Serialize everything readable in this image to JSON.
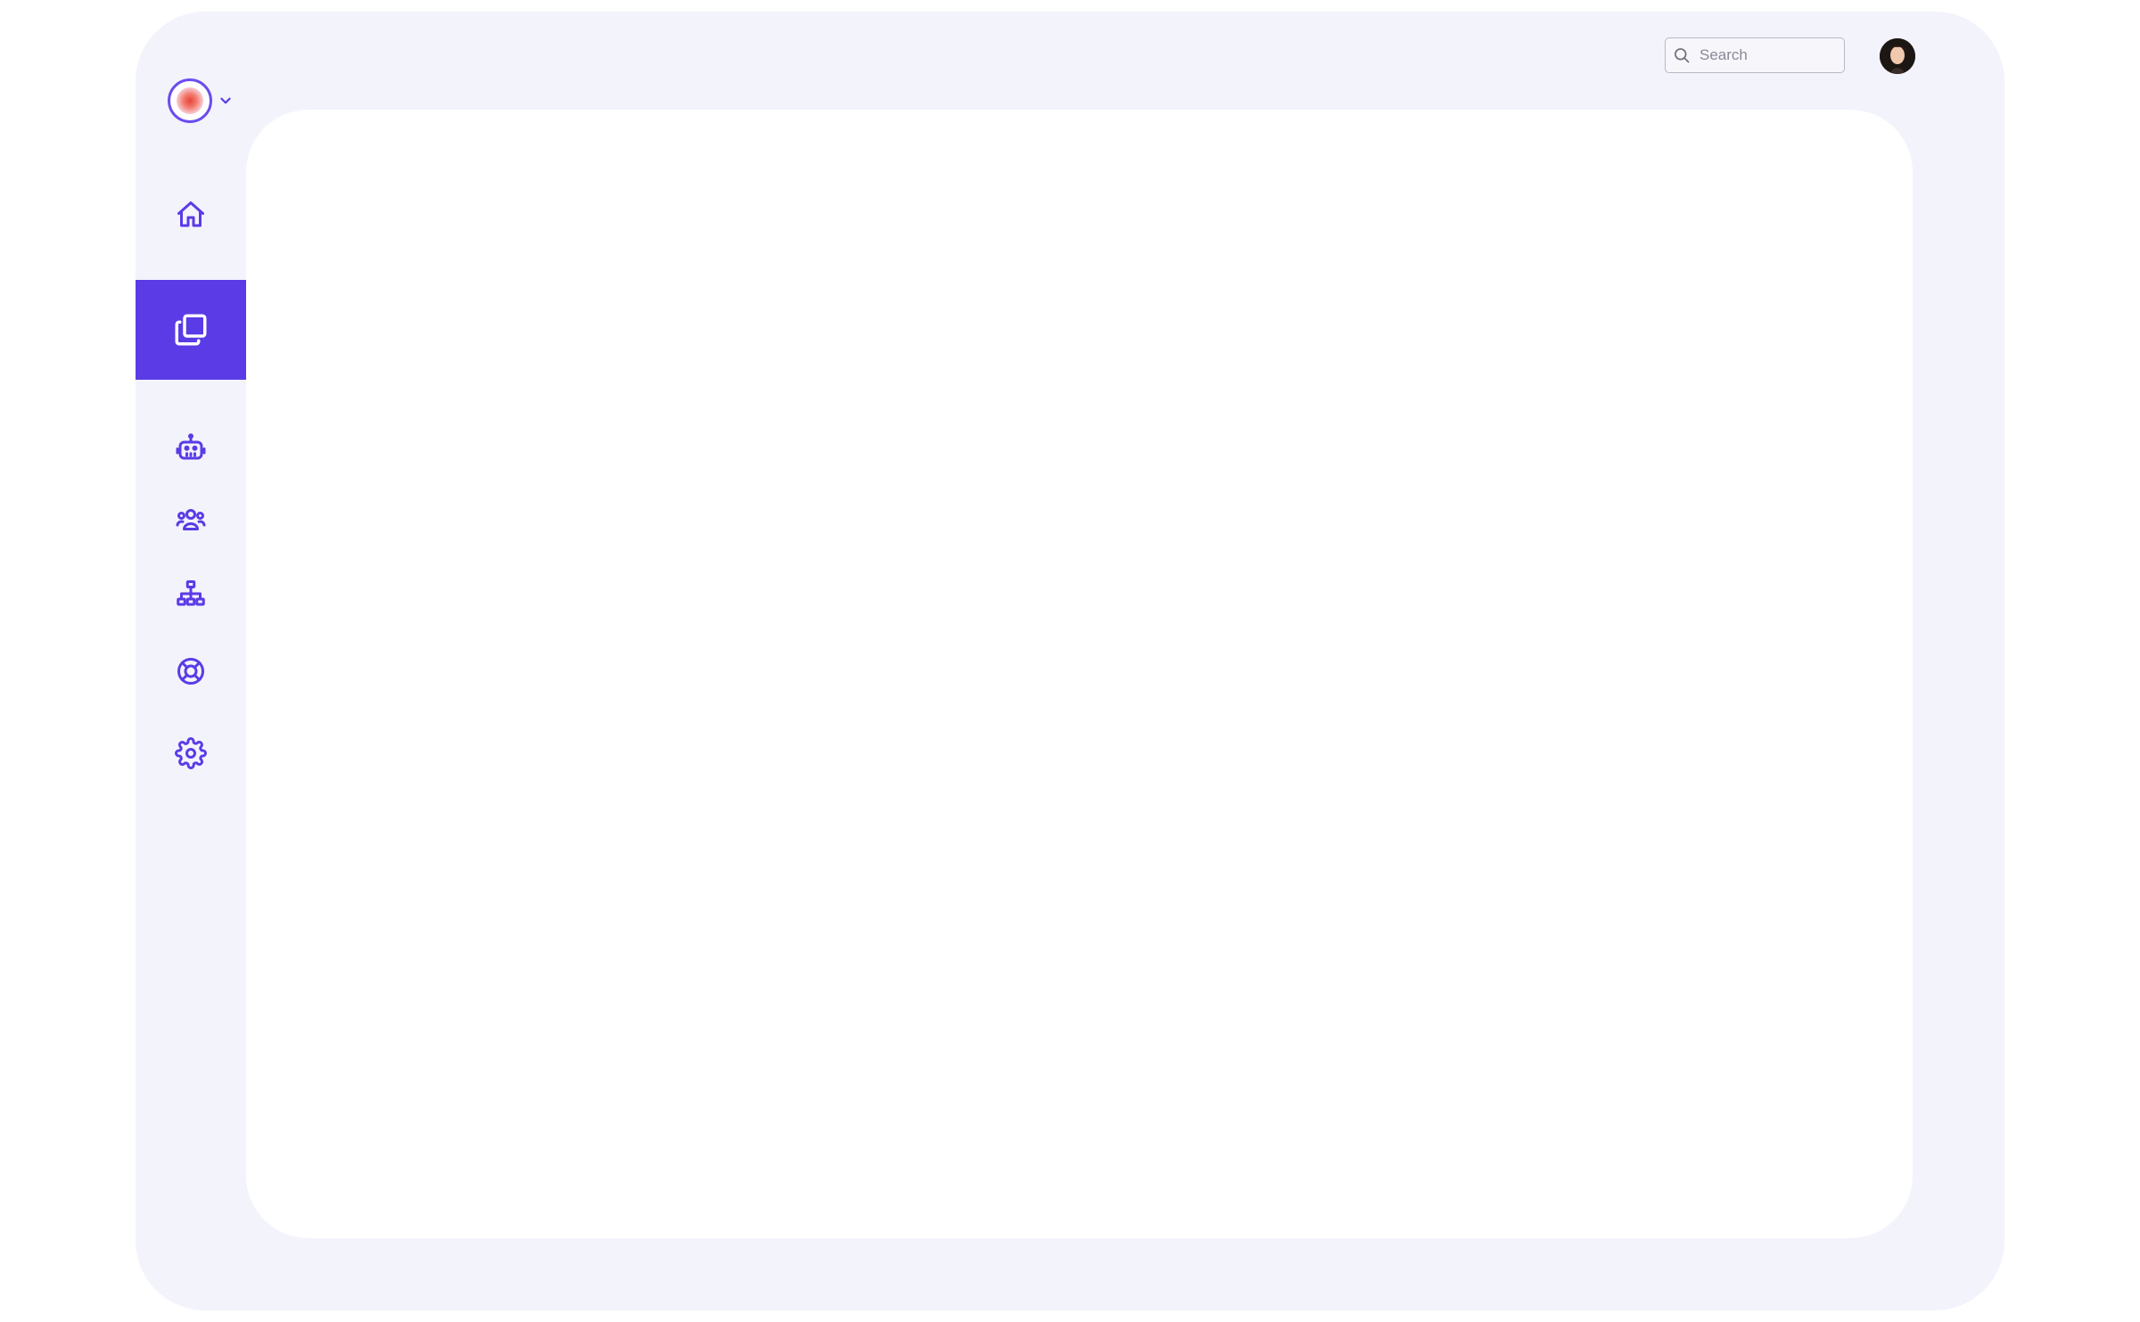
{
  "app": {
    "frame_color": "#f3f3fc",
    "accent_color": "#5b3be6"
  },
  "workspace_switcher": {
    "logo_icon": "workspace-logo-icon",
    "dropdown_icon": "chevron-down-icon"
  },
  "sidebar": {
    "items": [
      {
        "icon": "home-icon",
        "active": false
      },
      {
        "icon": "copy-icon",
        "active": true
      },
      {
        "icon": "robot-icon",
        "active": false
      },
      {
        "icon": "users-icon",
        "active": false
      },
      {
        "icon": "sitemap-icon",
        "active": false
      },
      {
        "icon": "lifebuoy-icon",
        "active": false
      },
      {
        "icon": "gear-icon",
        "active": false
      }
    ]
  },
  "header": {
    "search": {
      "placeholder": "Search",
      "value": "",
      "icon": "search-icon"
    },
    "avatar_icon": "user-avatar"
  }
}
